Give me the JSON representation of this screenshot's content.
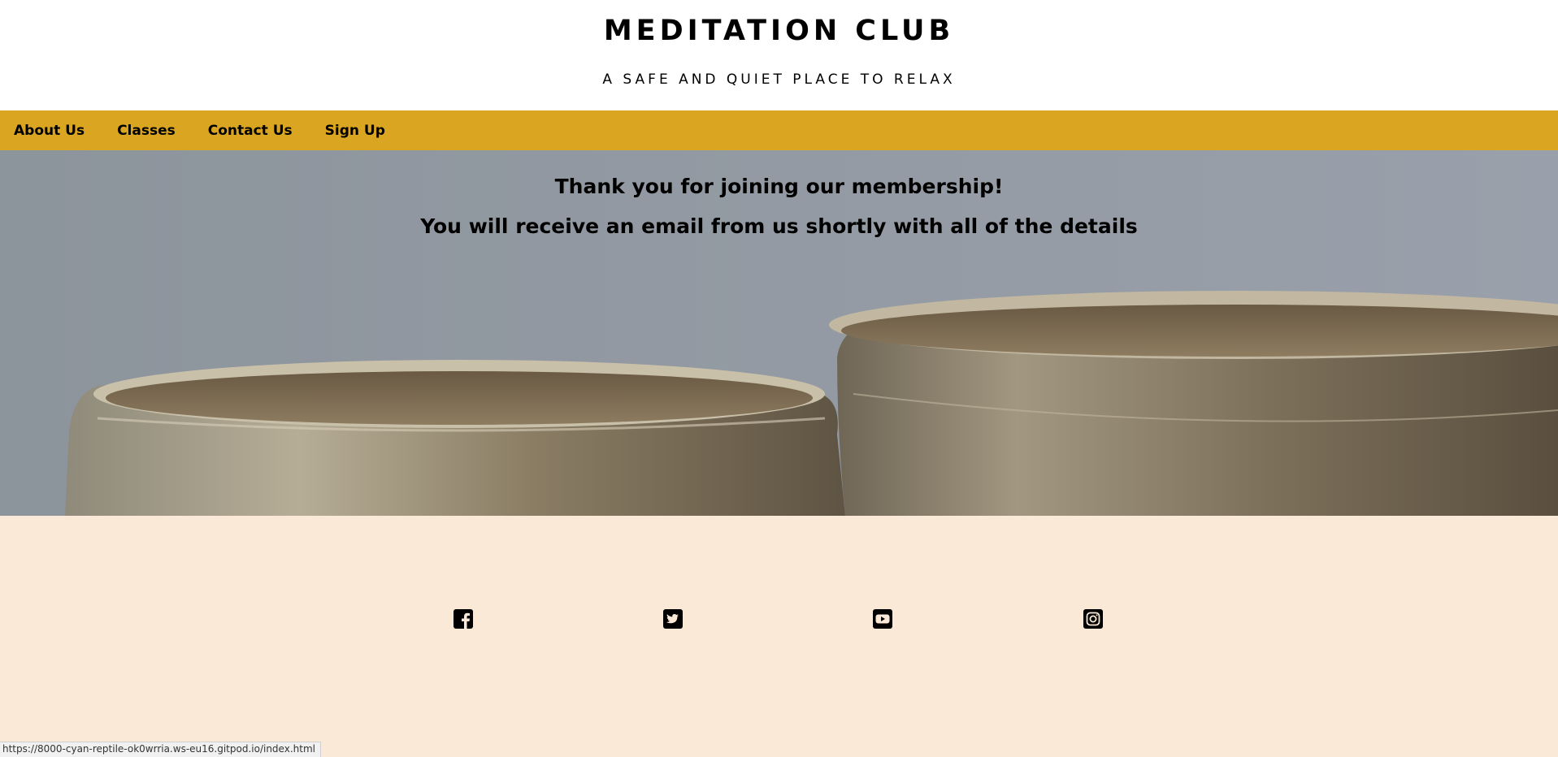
{
  "header": {
    "title": "MEDITATION CLUB",
    "tagline": "A SAFE AND QUIET PLACE TO RELAX"
  },
  "nav": {
    "items": [
      "About Us",
      "Classes",
      "Contact Us",
      "Sign Up"
    ]
  },
  "hero": {
    "line1": "Thank you for joining our membership!",
    "line2": "You will receive an email from us shortly with all of the details"
  },
  "footer": {
    "social_icons": [
      "facebook-icon",
      "twitter-icon",
      "youtube-icon",
      "instagram-icon"
    ]
  },
  "status_bar": {
    "url": "https://8000-cyan-reptile-ok0wrria.ws-eu16.gitpod.io/index.html"
  },
  "colors": {
    "nav_bg": "#daa520",
    "footer_bg": "#f9e9d6",
    "hero_bg": "#939aa3"
  }
}
